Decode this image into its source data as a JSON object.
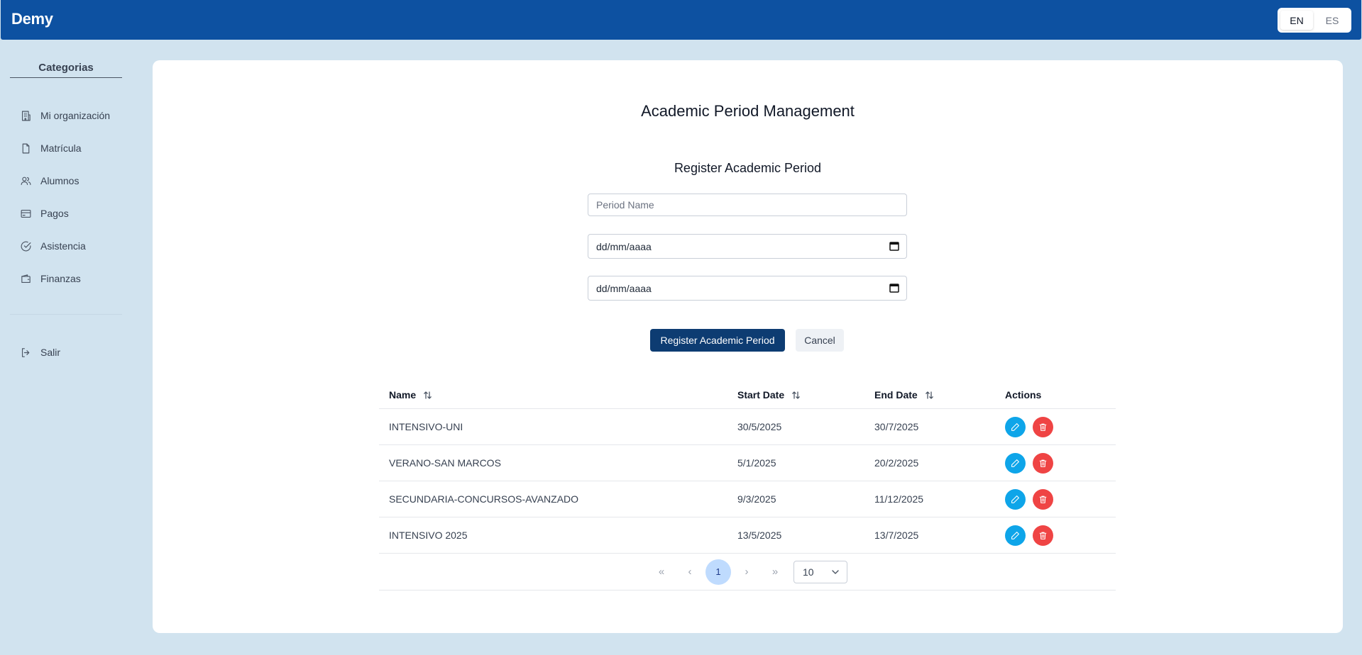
{
  "app": {
    "brand": "Demy"
  },
  "lang": {
    "en": "EN",
    "es": "ES",
    "active": "EN"
  },
  "sidebar": {
    "title": "Categorias",
    "items": [
      {
        "label": "Mi organización",
        "icon": "building-icon"
      },
      {
        "label": "Matrícula",
        "icon": "file-icon"
      },
      {
        "label": "Alumnos",
        "icon": "users-icon"
      },
      {
        "label": "Pagos",
        "icon": "credit-card-icon"
      },
      {
        "label": "Asistencia",
        "icon": "check-circle-icon"
      },
      {
        "label": "Finanzas",
        "icon": "wallet-icon"
      }
    ],
    "logout": {
      "label": "Salir",
      "icon": "logout-icon"
    }
  },
  "main": {
    "title": "Academic Period Management",
    "form": {
      "title": "Register Academic Period",
      "name_placeholder": "Period Name",
      "start_date_placeholder": "dd/mm/aaaa",
      "end_date_placeholder": "dd/mm/aaaa",
      "submit_label": "Register Academic Period",
      "cancel_label": "Cancel"
    },
    "table": {
      "headers": {
        "name": "Name",
        "start": "Start Date",
        "end": "End Date",
        "actions": "Actions"
      },
      "rows": [
        {
          "name": "INTENSIVO-UNI",
          "start": "30/5/2025",
          "end": "30/7/2025"
        },
        {
          "name": "VERANO-SAN MARCOS",
          "start": "5/1/2025",
          "end": "20/2/2025"
        },
        {
          "name": "SECUNDARIA-CONCURSOS-AVANZADO",
          "start": "9/3/2025",
          "end": "11/12/2025"
        },
        {
          "name": "INTENSIVO 2025",
          "start": "13/5/2025",
          "end": "13/7/2025"
        }
      ]
    },
    "pagination": {
      "first": "«",
      "prev": "‹",
      "current_page": "1",
      "next": "›",
      "last": "»",
      "page_size": "10"
    }
  },
  "colors": {
    "topbar": "#0d51a1",
    "background": "#d1e3ef",
    "primary_button": "#0d3c72",
    "edit_button": "#0ea5e9",
    "delete_button": "#ef4444",
    "current_page": "#bfdbfe"
  }
}
